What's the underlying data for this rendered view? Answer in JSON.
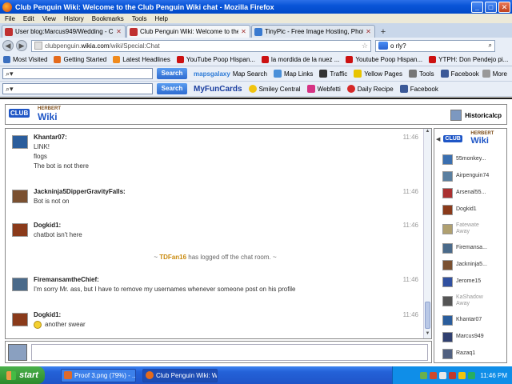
{
  "window": {
    "title": "Club Penguin Wiki: Welcome to the Club Penguin Wiki chat - Mozilla Firefox",
    "btn_min": "_",
    "btn_max": "□",
    "btn_close": "✕"
  },
  "menu": [
    "File",
    "Edit",
    "View",
    "History",
    "Bookmarks",
    "Tools",
    "Help"
  ],
  "tabs": [
    {
      "label": "User blog:Marcus949/Wedding - Club Pe...",
      "active": false,
      "icon": "wiki-icon"
    },
    {
      "label": "Club Penguin Wiki: Welcome to the Club ...",
      "active": true,
      "icon": "wiki-icon"
    },
    {
      "label": "TinyPic - Free Image Hosting, Photo Shar...",
      "active": false,
      "icon": "tinypic-icon"
    }
  ],
  "tab_new": "+",
  "nav": {
    "back": "◀",
    "forward": "▶",
    "url_prefix": "clubpenguin.",
    "url_domain": "wikia.com",
    "url_path": "/wiki/Special:Chat",
    "star": "☆",
    "search_value": "o rly?"
  },
  "bookmarks": [
    {
      "label": "Most Visited",
      "icon": "bookmarks-icon",
      "color": "#3b6fbf"
    },
    {
      "label": "Getting Started",
      "icon": "firefox-icon",
      "color": "#e46a1c"
    },
    {
      "label": "Latest Headlines",
      "icon": "rss-icon",
      "color": "#f08a1c"
    },
    {
      "label": "YouTube Poop Hispan...",
      "icon": "youtube-icon",
      "color": "#cc1111"
    },
    {
      "label": "la mordida de la nuez ...",
      "icon": "youtube-icon",
      "color": "#cc1111"
    },
    {
      "label": "Youtube Poop Hispan...",
      "icon": "youtube-icon",
      "color": "#cc1111"
    },
    {
      "label": "YTPH: Don Pendejo pi...",
      "icon": "youtube-icon",
      "color": "#cc1111"
    }
  ],
  "toolbar1": {
    "search_placeholder": "",
    "search_button": "Search",
    "items": [
      {
        "label": "Map Search",
        "icon": "mapsgalaxy-icon",
        "color": "#2c7ad6",
        "brand": "mapsgalaxy"
      },
      {
        "label": "Map Links",
        "icon": "map-icon",
        "color": "#4a90d9"
      },
      {
        "label": "Traffic",
        "icon": "traffic-icon",
        "color": "#333"
      },
      {
        "label": "Yellow Pages",
        "icon": "yp-icon",
        "color": "#e8c400"
      },
      {
        "label": "Tools",
        "icon": "tools-icon",
        "color": "#777"
      },
      {
        "label": "Facebook",
        "icon": "facebook-icon",
        "color": "#3b5998"
      }
    ]
  },
  "toolbar2": {
    "search_button": "Search",
    "brand": "MyFunCards",
    "items": [
      {
        "label": "Smiley Central",
        "icon": "smiley-icon",
        "color": "#f1c40f"
      },
      {
        "label": "Webfetti",
        "icon": "webfetti-icon",
        "color": "#d63384"
      },
      {
        "label": "Daily Recipe",
        "icon": "recipe-icon",
        "color": "#d62828"
      },
      {
        "label": "Facebook",
        "icon": "facebook-icon",
        "color": "#3b5998"
      }
    ]
  },
  "more_label": "More",
  "wiki": {
    "logo_top": "CLUB",
    "logo_herbert": "HERBERT",
    "logo_wiki": "Wiki",
    "current_user": "Historicalcp"
  },
  "messages": [
    {
      "user": "Khantar07:",
      "time": "11:46",
      "lines": [
        "LINK!",
        "flogs",
        "The bot is not there"
      ],
      "avatar_color": "#2a5d9c"
    },
    {
      "user": "Jackninja5DipperGravityFalls:",
      "time": "11:46",
      "lines": [
        "Bot is not on"
      ],
      "avatar_color": "#7a5030"
    },
    {
      "user": "Dogkid1:",
      "time": "11:46",
      "lines": [
        "chatbot isn't here"
      ],
      "avatar_color": "#8a3a1a"
    },
    {
      "user": "FiremansamtheChief:",
      "time": "11:46",
      "lines": [
        "I'm sorry Mr. ass, but I have to remove my usernames whenever someone post on his profile"
      ],
      "avatar_color": "#4a6a8a"
    },
    {
      "user": "Dogkid1:",
      "time": "11:46",
      "lines": [
        "another swear"
      ],
      "avatar_color": "#8a3a1a",
      "emoticon": true
    }
  ],
  "system_message": {
    "prefix": "~ ",
    "user": "TDFan16",
    "text": " has logged off the chat room. ~"
  },
  "users": [
    {
      "name": "55monkey...",
      "away": false,
      "color": "#3a6fb0"
    },
    {
      "name": "Airpenguin74",
      "away": false,
      "color": "#5a7fa0"
    },
    {
      "name": "Arsenal55...",
      "away": false,
      "color": "#aa3030"
    },
    {
      "name": "Dogkid1",
      "away": false,
      "color": "#8a3a1a"
    },
    {
      "name": "Fatewate",
      "sub": "Away",
      "away": true,
      "color": "#b0a070"
    },
    {
      "name": "Firemansa...",
      "away": false,
      "color": "#4a6a8a"
    },
    {
      "name": "Jackninja5...",
      "away": false,
      "color": "#7a5030"
    },
    {
      "name": "Jerome15",
      "away": false,
      "color": "#3050a0"
    },
    {
      "name": "KaShadow",
      "sub": "Away",
      "away": true,
      "color": "#555"
    },
    {
      "name": "Khantar07",
      "away": false,
      "color": "#2a5d9c"
    },
    {
      "name": "Marcus949",
      "away": false,
      "color": "#304070"
    },
    {
      "name": "Razaq1",
      "away": false,
      "color": "#506080"
    }
  ],
  "taskbar": {
    "start": "start",
    "tasks": [
      {
        "label": "Proof 3.png (79%) - ...",
        "icon": "paint-icon",
        "color": "#dd6a2a",
        "active": false
      },
      {
        "label": "Club Penguin Wiki: W...",
        "icon": "firefox-icon",
        "color": "#e46a1c",
        "active": true
      }
    ],
    "clock": "11:46 PM"
  }
}
